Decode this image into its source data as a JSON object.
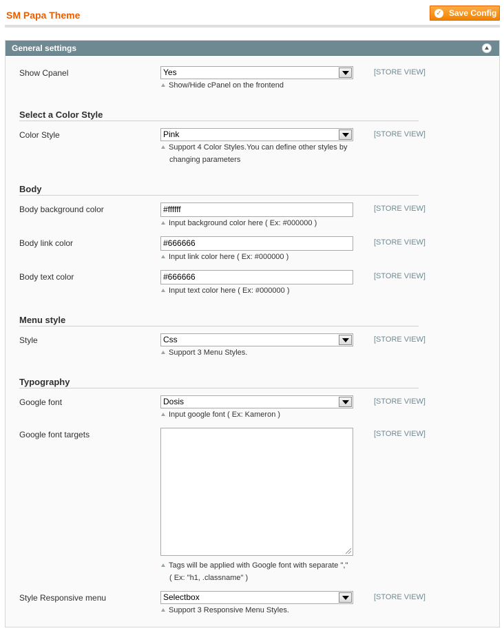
{
  "header": {
    "title": "SM Papa Theme",
    "save_label": "Save Config"
  },
  "fieldset": {
    "title": "General settings"
  },
  "fields": {
    "show_cpanel": {
      "label": "Show Cpanel",
      "value": "Yes",
      "note": "Show/Hide cPanel on the frontend",
      "scope": "[STORE VIEW]"
    },
    "color_style": {
      "label": "Color Style",
      "value": "Pink",
      "note_line1": "Support 4 Color Styles.You can define other styles by",
      "note_line2": "changing parameters",
      "scope": "[STORE VIEW]"
    },
    "body_bg": {
      "label": "Body background color",
      "value": "#ffffff",
      "note": "Input background color here ( Ex: #000000 )",
      "scope": "[STORE VIEW]"
    },
    "body_link": {
      "label": "Body link color",
      "value": "#666666",
      "note": "Input link color here ( Ex: #000000 )",
      "scope": "[STORE VIEW]"
    },
    "body_text": {
      "label": "Body text color",
      "value": "#666666",
      "note": "Input text color here ( Ex: #000000 )",
      "scope": "[STORE VIEW]"
    },
    "menu_style": {
      "label": "Style",
      "value": "Css",
      "note": "Support 3 Menu Styles.",
      "scope": "[STORE VIEW]"
    },
    "google_font": {
      "label": "Google font",
      "value": "Dosis",
      "note": "Input google font ( Ex: Kameron )",
      "scope": "[STORE VIEW]"
    },
    "google_font_targets": {
      "label": "Google font targets",
      "value": "",
      "note_line1": "Tags will be applied with Google font with separate \",\"",
      "note_line2": "( Ex: \"h1, .classname\" )",
      "scope": "[STORE VIEW]"
    },
    "responsive_menu": {
      "label": "Style Responsive menu",
      "value": "Selectbox",
      "note": "Support 3 Responsive Menu Styles.",
      "scope": "[STORE VIEW]"
    }
  },
  "sections": {
    "color": "Select a Color Style",
    "body": "Body",
    "menu": "Menu style",
    "typography": "Typography"
  }
}
